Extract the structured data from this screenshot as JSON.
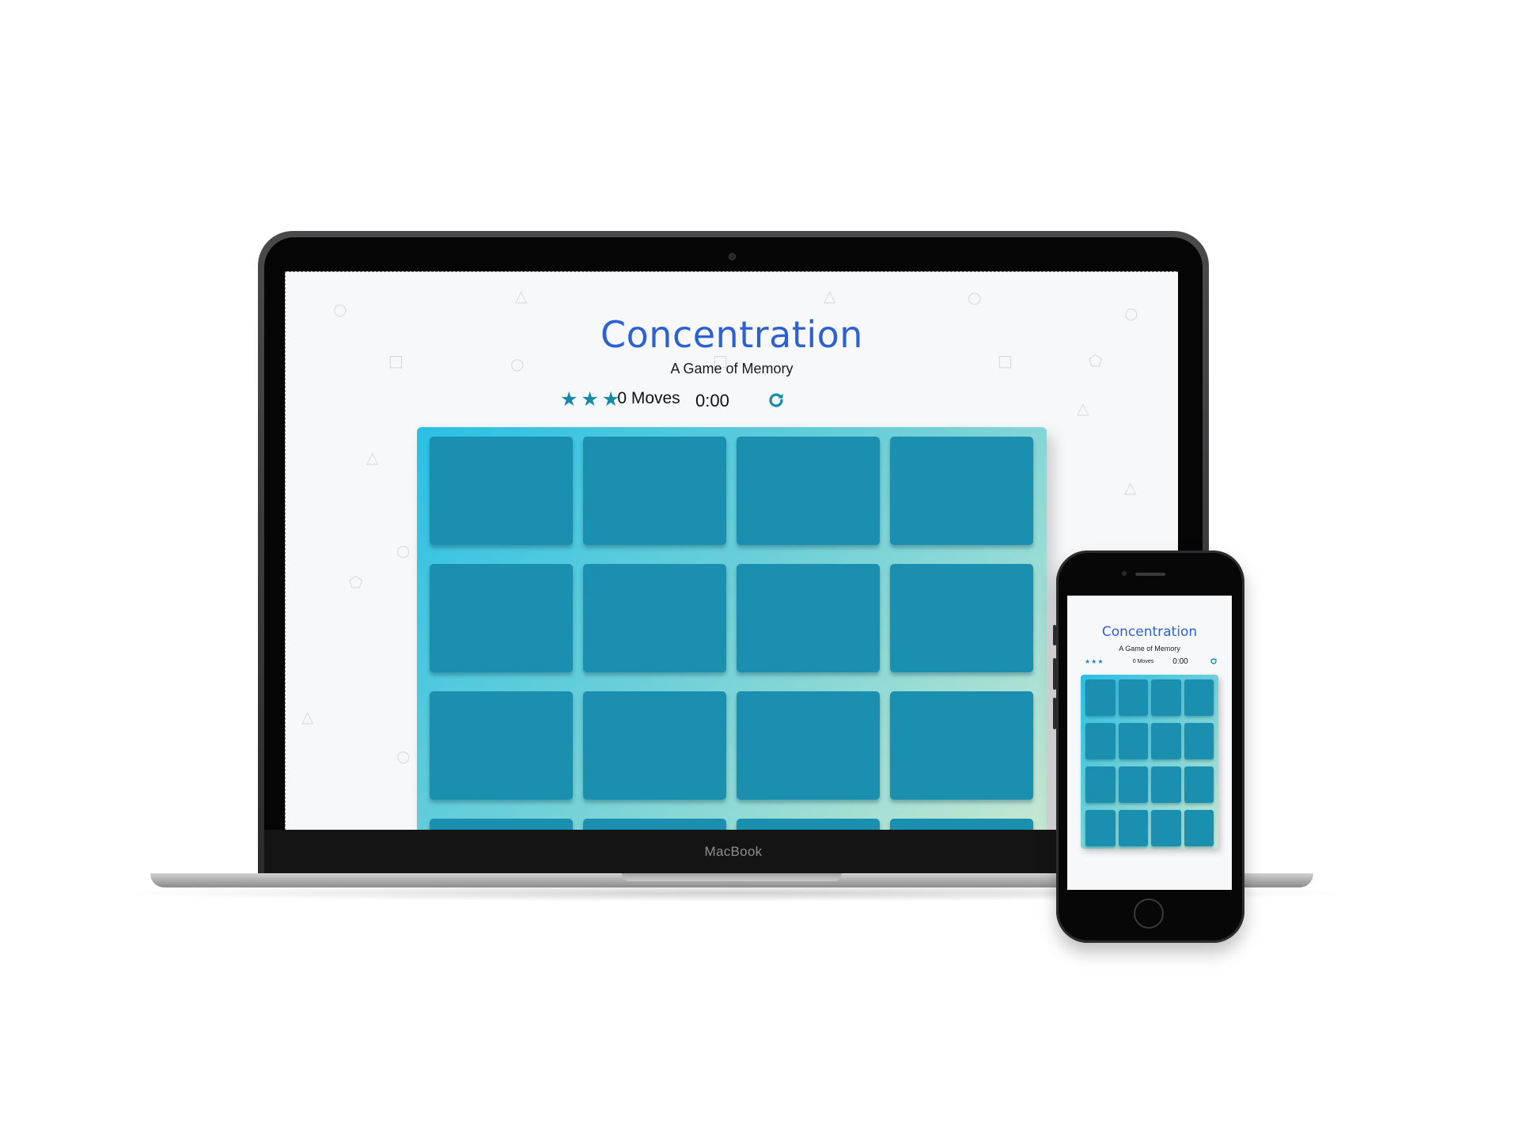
{
  "game": {
    "title": "Concentration",
    "subtitle": "A Game of Memory",
    "stars": 3,
    "moves_label": "0 Moves",
    "timer": "0:00",
    "card_count": 16,
    "restart_icon": "restart-icon",
    "star_icon": "star-icon",
    "colors": {
      "title": "#2e61d0",
      "accent": "#168aa6",
      "card": "#1a8fb0",
      "deck_start": "#2ac0e6",
      "deck_end": "#c9e9d1"
    }
  },
  "laptop": {
    "brand": "MacBook"
  }
}
